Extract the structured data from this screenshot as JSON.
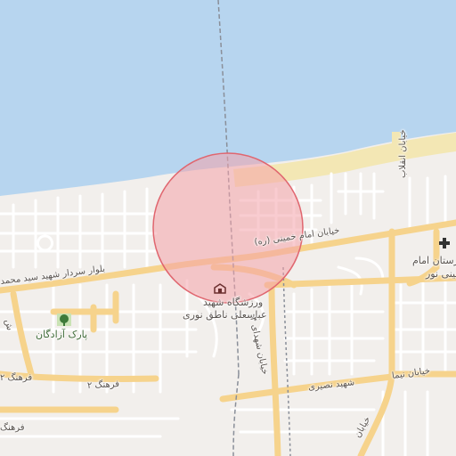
{
  "colors": {
    "sea": "#b7d5ef",
    "land": "#f2efec",
    "beach": "#f3e7b4",
    "major_road": "#f6d38c",
    "minor_road": "#ffffff",
    "circle_fill": "#f4a3aa",
    "circle_stroke": "#e0666f",
    "park": "#c9e3b4"
  },
  "map": {
    "poi_label_line1": "ورزشگاه شهید",
    "poi_label_line2": "عباسعلی ناطق نوری",
    "poi_icon": "stadium-icon",
    "park_label": "پارک آزادگان",
    "park_icon": "tree-icon",
    "hospital_icon": "hospital-cross-icon",
    "hospital_label_line1": "بیمارستان امام",
    "hospital_label_line2": "خمینی نور",
    "road_khomeini": "خیابان امام خمینی (ره)",
    "road_boulevard": "بلوار سردار شهید سید محمد",
    "road_farhang2_a": "فرهنگ ۲",
    "road_farhang2_b": "فرهنگ ۲",
    "road_farhang_c": "فرهنگ",
    "road_shohada": "خیابان شهدای ۴",
    "road_nasiri": "شهید نصیری",
    "road_enghelab": "خیابان انقلاب",
    "road_nima": "خیابان نیما",
    "road_bottom": "خیابان",
    "road_left_edge": "ش",
    "highlight": "circle"
  }
}
